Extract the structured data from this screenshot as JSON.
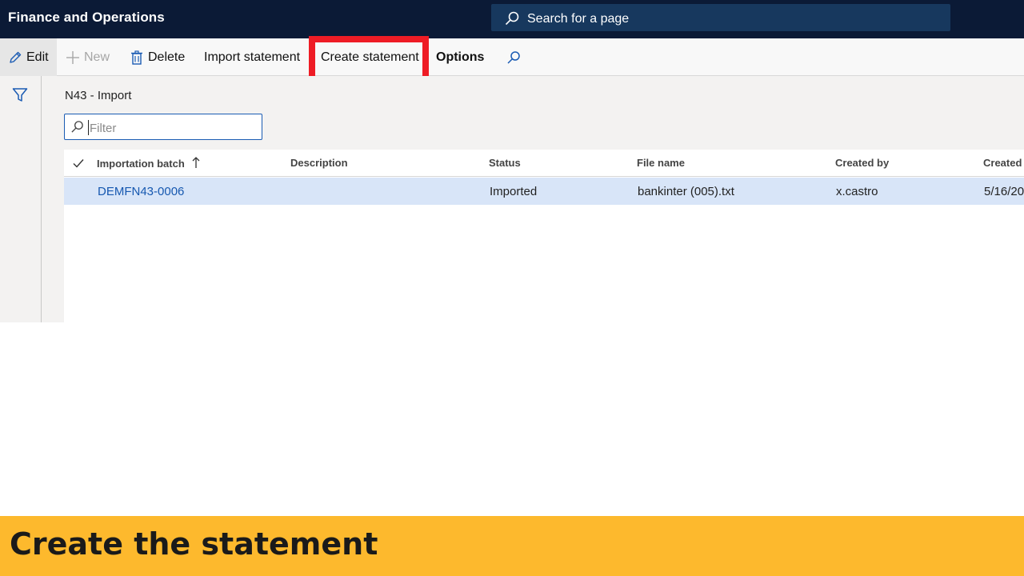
{
  "app": {
    "title": "Finance and Operations"
  },
  "search": {
    "placeholder": "Search for a page"
  },
  "toolbar": {
    "edit_label": "Edit",
    "new_label": "New",
    "delete_label": "Delete",
    "import_label": "Import statement",
    "create_label": "Create statement",
    "options_label": "Options"
  },
  "page": {
    "title": "N43 - Import"
  },
  "filter": {
    "placeholder": "Filter",
    "value": ""
  },
  "grid": {
    "columns": [
      "Importation batch",
      "Description",
      "Status",
      "File name",
      "Created by",
      "Created"
    ],
    "sort_column": "Importation batch",
    "sort_direction": "ascending",
    "rows": [
      {
        "batch": "DEMFN43-0006",
        "description": "",
        "status": "Imported",
        "file_name": "bankinter (005).txt",
        "created_by": "x.castro",
        "created": "5/16/20"
      }
    ]
  },
  "banner": {
    "text": "Create the statement"
  },
  "icons": {
    "edit": "pencil-icon",
    "new": "plus-icon",
    "delete": "trash-icon",
    "find": "search-icon",
    "filter_rail": "funnel-icon",
    "search": "search-icon",
    "select_all": "checkmark-icon",
    "sort": "arrow-up-icon"
  },
  "colors": {
    "topbar": "#0b1a36",
    "searchbox": "#17385e",
    "highlight": "#ee1c25",
    "selected_row": "#d8e5f8",
    "link": "#1658b0",
    "banner": "#fdb92d"
  }
}
